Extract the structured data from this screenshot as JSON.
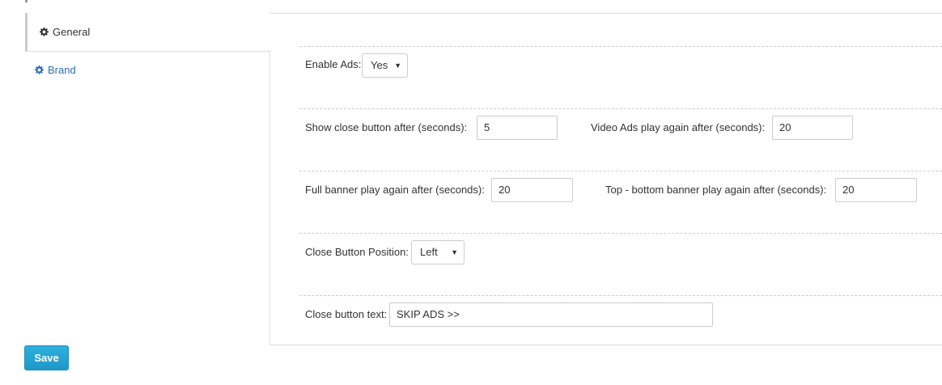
{
  "tabs": {
    "general": {
      "label": "General",
      "icon": "gear-icon"
    },
    "brand": {
      "label": "Brand",
      "icon": "gear-icon"
    }
  },
  "form": {
    "enable_ads": {
      "label": "Enable Ads:",
      "value": "Yes"
    },
    "close_after": {
      "label": "Show close button after (seconds):",
      "value": "5"
    },
    "video_again": {
      "label": "Video Ads play again after (seconds):",
      "value": "20"
    },
    "full_banner_again": {
      "label": "Full banner play again after (seconds):",
      "value": "20"
    },
    "top_bottom_again": {
      "label": "Top - bottom banner play again after (seconds):",
      "value": "20"
    },
    "close_position": {
      "label": "Close Button Position:",
      "value": "Left"
    },
    "close_text": {
      "label": "Close button text:",
      "value": "SKIP ADS >>"
    }
  },
  "save_label": "Save",
  "colors": {
    "link": "#2a6ebb",
    "save_button": "#2aa8d8"
  }
}
